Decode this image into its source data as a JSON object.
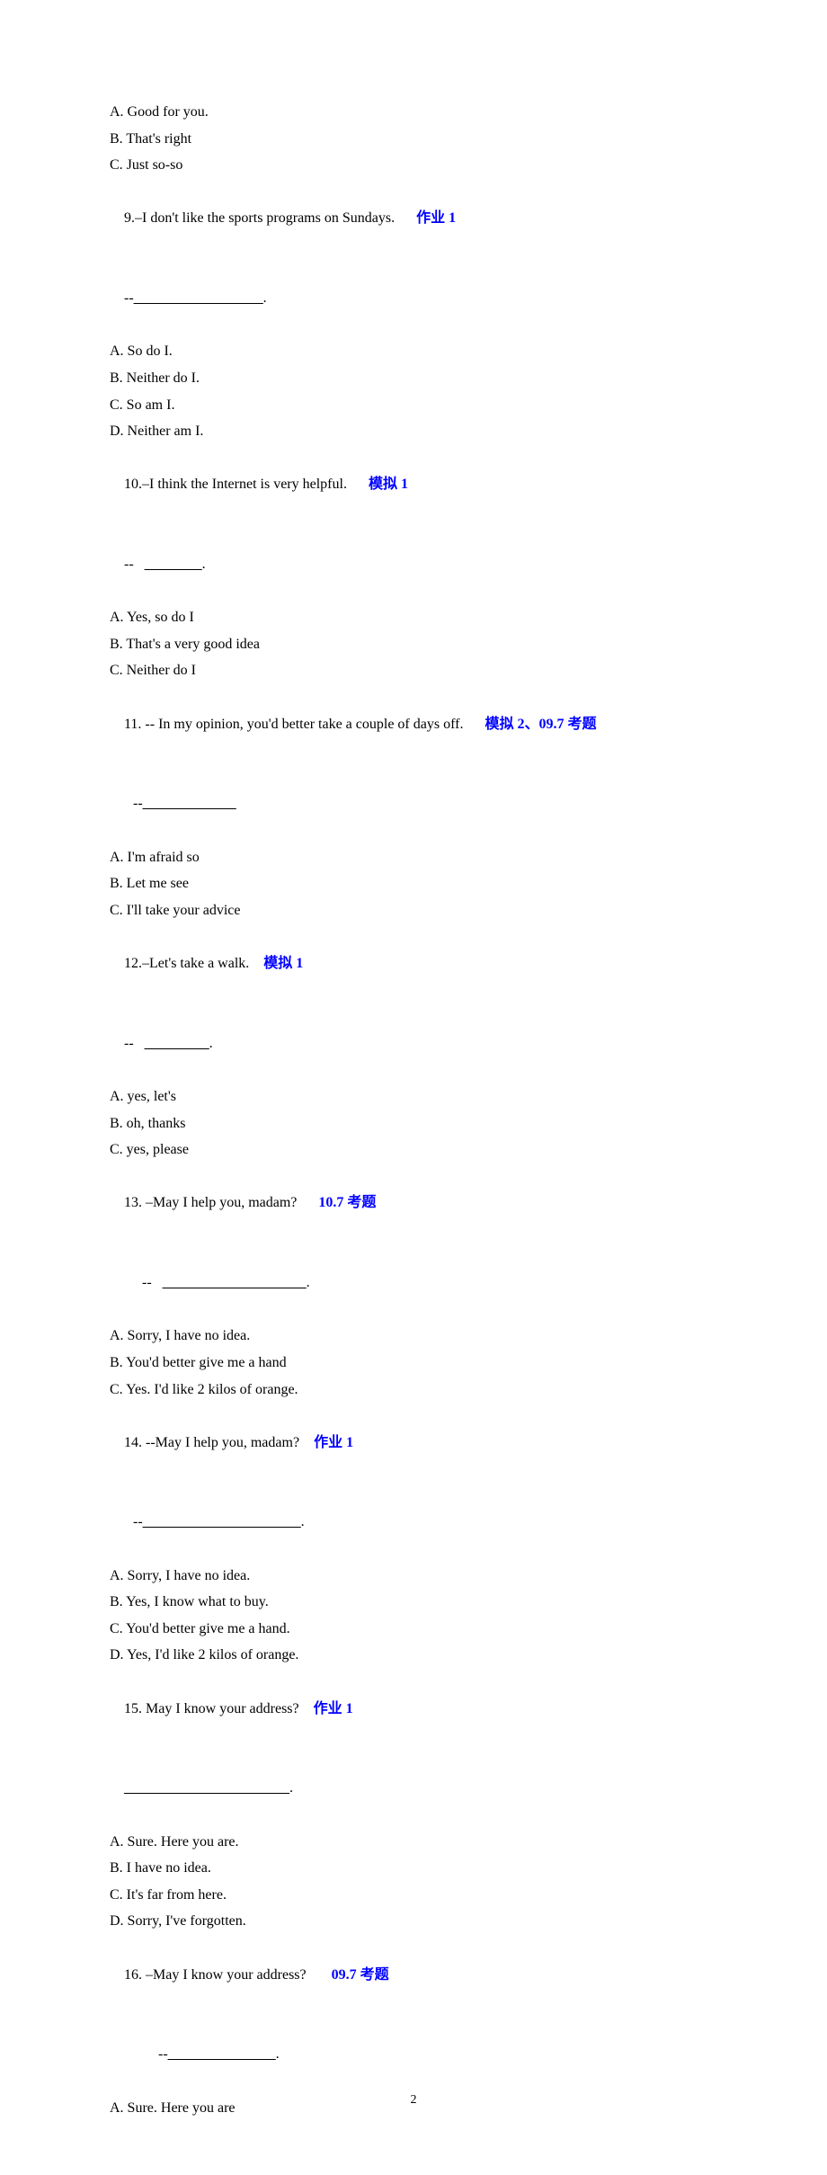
{
  "q8_intro_options": {
    "a": "A. Good for you.",
    "b": "B. That's right",
    "c": "C. Just so-so"
  },
  "q9": {
    "prompt": "9.–I don't like the sports programs on Sundays.",
    "tag": "作业 1",
    "blank_prefix": "--",
    "blank": "__________________",
    "blank_suffix": ".",
    "a": "A. So do I.",
    "b": "B. Neither do I.",
    "c": "C. So am I.",
    "d": "D. Neither am I."
  },
  "q10": {
    "prompt": "10.–I think the Internet is very helpful.",
    "tag": "模拟 1",
    "blank_prefix": "--   ",
    "blank": "________",
    "blank_suffix": ".",
    "a": "A. Yes, so do I",
    "b": "B. That's a very good idea",
    "c": "C. Neither do I"
  },
  "q11": {
    "prompt": "11. -- In my opinion, you'd better take a couple of days off.",
    "tag": "模拟 2、09.7 考题",
    "blank_prefix": "--",
    "blank": "_____________",
    "a": "A. I'm afraid so",
    "b": "B. Let me see",
    "c": "C. I'll take your advice"
  },
  "q12": {
    "prompt": "12.–Let's take a walk.",
    "tag": "模拟 1",
    "blank_prefix": "--   ",
    "blank": "_________",
    "blank_suffix": ".",
    "a": "A. yes, let's",
    "b": "B. oh, thanks",
    "c": "C. yes, please"
  },
  "q13": {
    "prompt": "13. –May I help you, madam?",
    "tag": "10.7 考题",
    "blank_prefix": "--   ",
    "blank": "____________________",
    "blank_suffix": ".",
    "a": "A. Sorry, I have no idea.",
    "b": "B. You'd better give me a hand",
    "c": "C. Yes. I'd like 2 kilos of orange."
  },
  "q14": {
    "prompt": "14. --May I help you, madam?",
    "tag": "作业 1",
    "blank_prefix": "--",
    "blank": "______________________",
    "blank_suffix": ".",
    "a": "A. Sorry, I have no idea.",
    "b": "B. Yes, I know what to buy.",
    "c": "C. You'd better give me a hand.",
    "d": "D. Yes, I'd like 2 kilos of orange."
  },
  "q15": {
    "prompt": "15. May I know your address?",
    "tag": "作业 1",
    "blank": "_______________________",
    "blank_suffix": ".",
    "a": "A. Sure. Here you are.",
    "b": "B. I have no idea.",
    "c": "C. It's far from here.",
    "d": "D. Sorry, I've forgotten."
  },
  "q16": {
    "prompt": "16. –May I know your address?",
    "tag": "09.7 考题",
    "blank_prefix": "--",
    "blank": "_______________",
    "blank_suffix": ".",
    "a": "A. Sure. Here you are"
  },
  "page_number": "2"
}
